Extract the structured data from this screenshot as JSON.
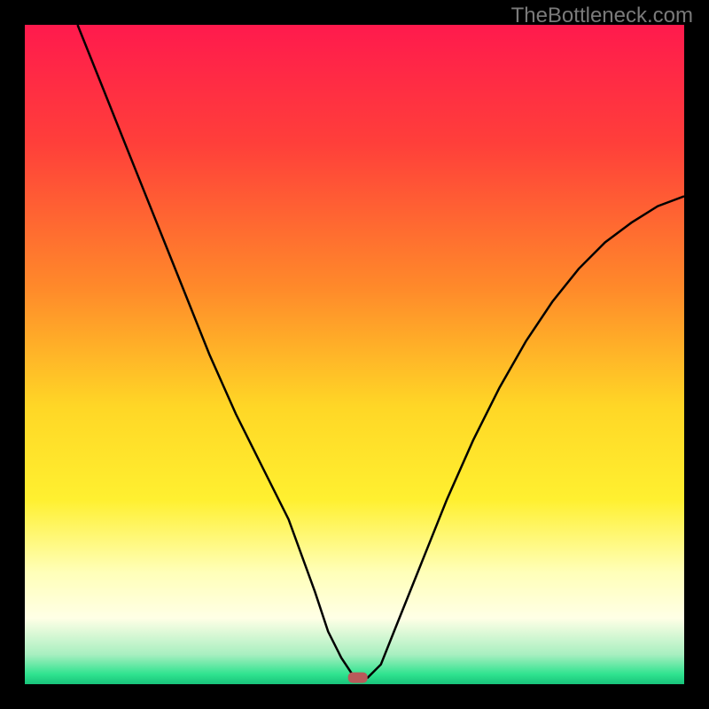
{
  "watermark": "TheBottleneck.com",
  "chart_data": {
    "type": "line",
    "title": "",
    "xlabel": "",
    "ylabel": "",
    "xlim": [
      0,
      100
    ],
    "ylim": [
      0,
      100
    ],
    "series": [
      {
        "name": "curve",
        "x": [
          8,
          12,
          16,
          20,
          24,
          28,
          32,
          36,
          40,
          44,
          46,
          48,
          50,
          52,
          54,
          56,
          60,
          64,
          68,
          72,
          76,
          80,
          84,
          88,
          92,
          96,
          100
        ],
        "y": [
          100,
          90,
          80,
          70,
          60,
          50,
          41,
          33,
          25,
          14,
          8,
          4,
          1,
          1,
          3,
          8,
          18,
          28,
          37,
          45,
          52,
          58,
          63,
          67,
          70,
          72.5,
          74
        ]
      }
    ],
    "marker": {
      "x": 50.5,
      "y": 1,
      "color": "#b85a5a"
    },
    "background_gradient": {
      "stops": [
        {
          "offset": 0,
          "color": "#ff1a4d"
        },
        {
          "offset": 0.18,
          "color": "#ff3f3a"
        },
        {
          "offset": 0.4,
          "color": "#ff8a2a"
        },
        {
          "offset": 0.58,
          "color": "#ffd726"
        },
        {
          "offset": 0.72,
          "color": "#fff030"
        },
        {
          "offset": 0.83,
          "color": "#ffffb8"
        },
        {
          "offset": 0.9,
          "color": "#ffffe6"
        },
        {
          "offset": 0.955,
          "color": "#a8efc0"
        },
        {
          "offset": 0.985,
          "color": "#2fe38f"
        },
        {
          "offset": 1.0,
          "color": "#18c37a"
        }
      ]
    }
  }
}
